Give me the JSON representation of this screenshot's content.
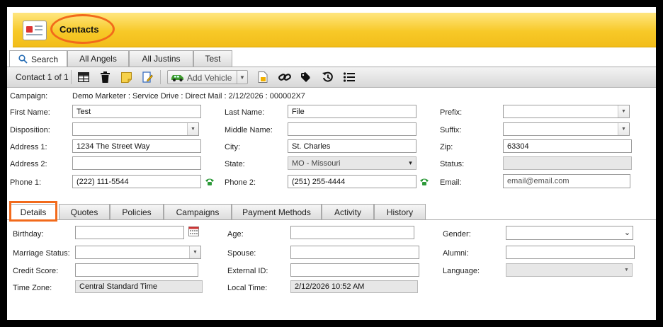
{
  "header": {
    "title": "Contacts",
    "icon": "contacts-card-icon",
    "highlight_color": "#f26a1b"
  },
  "top_tabs": [
    {
      "label": "Search",
      "icon": "search-icon",
      "active": true
    },
    {
      "label": "All Angels"
    },
    {
      "label": "All Justins"
    },
    {
      "label": "Test"
    }
  ],
  "toolbar": {
    "contact_counter": "Contact 1 of 1",
    "icons": [
      "grid-icon",
      "trash-icon",
      "sticky-note-icon",
      "edit-icon",
      "document-icon",
      "link-icon",
      "tag-icon",
      "history-icon",
      "list-icon"
    ],
    "add_vehicle_label": "Add Vehicle"
  },
  "contact": {
    "campaign_label": "Campaign:",
    "campaign_value": "Demo Marketer : Service Drive : Direct Mail : 2/12/2026 : 000002X7",
    "first_name_label": "First Name:",
    "first_name": "Test",
    "last_name_label": "Last Name:",
    "last_name": "File",
    "prefix_label": "Prefix:",
    "prefix": "",
    "disposition_label": "Disposition:",
    "disposition": "",
    "middle_name_label": "Middle Name:",
    "middle_name": "",
    "suffix_label": "Suffix:",
    "suffix": "",
    "address1_label": "Address 1:",
    "address1": "1234 The Street Way",
    "city_label": "City:",
    "city": "St. Charles",
    "zip_label": "Zip:",
    "zip": "63304",
    "address2_label": "Address 2:",
    "address2": "",
    "state_label": "State:",
    "state": "MO - Missouri",
    "status_label": "Status:",
    "status": "",
    "phone1_label": "Phone 1:",
    "phone1": "(222) 111-5544",
    "phone2_label": "Phone 2:",
    "phone2": "(251) 255-4444",
    "email_label": "Email:",
    "email_placeholder": "email@email.com"
  },
  "detail_tabs": [
    {
      "label": "Details",
      "active": true
    },
    {
      "label": "Quotes"
    },
    {
      "label": "Policies"
    },
    {
      "label": "Campaigns"
    },
    {
      "label": "Payment Methods"
    },
    {
      "label": "Activity"
    },
    {
      "label": "History"
    }
  ],
  "details": {
    "birthday_label": "Birthday:",
    "birthday": "",
    "age_label": "Age:",
    "age": "",
    "gender_label": "Gender:",
    "gender": "",
    "marriage_label": "Marriage Status:",
    "marriage": "",
    "spouse_label": "Spouse:",
    "spouse": "",
    "alumni_label": "Alumni:",
    "alumni": "",
    "credit_label": "Credit Score:",
    "credit": "",
    "external_label": "External ID:",
    "external": "",
    "language_label": "Language:",
    "language": "",
    "timezone_label": "Time Zone:",
    "timezone": "Central Standard Time",
    "localtime_label": "Local Time:",
    "localtime": "2/12/2026 10:52 AM"
  }
}
